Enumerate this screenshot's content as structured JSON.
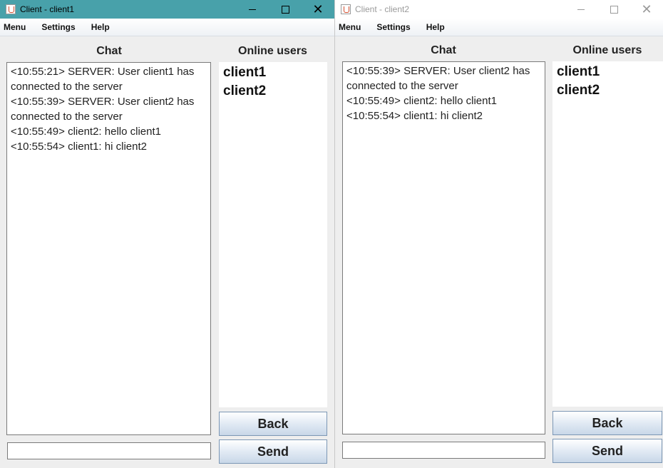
{
  "windows": [
    {
      "title": "Client - client1",
      "menu": [
        "Menu",
        "Settings",
        "Help"
      ],
      "chat_heading": "Chat",
      "users_heading": "Online users",
      "chat_lines": [
        "<10:55:21> SERVER: User client1 has connected to the server",
        "<10:55:39> SERVER: User client2 has connected to the server",
        "<10:55:49> client2: hello client1",
        "<10:55:54> client1: hi client2"
      ],
      "users": [
        "client1",
        "client2"
      ],
      "message_input": "",
      "back_label": "Back",
      "send_label": "Send",
      "active": true
    },
    {
      "title": "Client - client2",
      "menu": [
        "Menu",
        "Settings",
        "Help"
      ],
      "chat_heading": "Chat",
      "users_heading": "Online users",
      "chat_lines": [
        "<10:55:39> SERVER: User client2 has connected to the server",
        "<10:55:49> client2: hello client1",
        "<10:55:54> client1: hi client2"
      ],
      "users": [
        "client1",
        "client2"
      ],
      "message_input": "",
      "back_label": "Back",
      "send_label": "Send",
      "active": false
    }
  ],
  "colors": {
    "active_titlebar": "#48a1aa",
    "inactive_titlebar": "#ffffff",
    "window_background": "#eeeeee"
  },
  "icons": {
    "title_icon": "java-cup-icon",
    "minimize": "minimize-icon",
    "maximize": "maximize-icon",
    "close": "close-icon"
  }
}
